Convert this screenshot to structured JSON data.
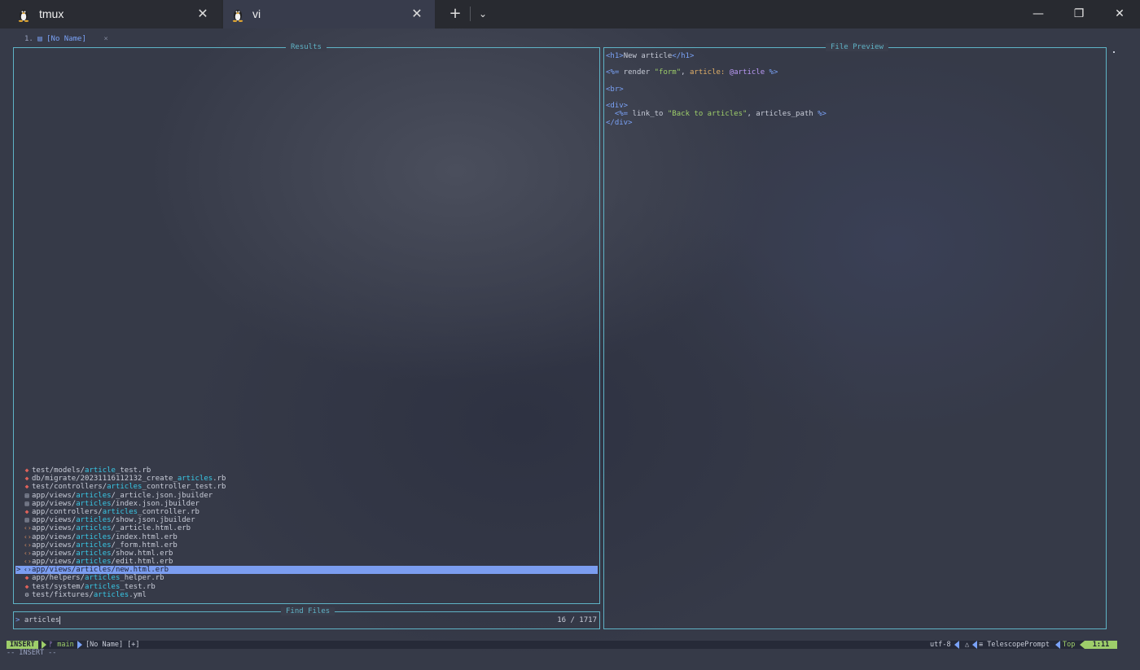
{
  "window": {
    "tabs": [
      {
        "label": "tmux",
        "icon": "linux-penguin-icon"
      },
      {
        "label": "vi",
        "icon": "linux-penguin-icon"
      }
    ],
    "close_glyph": "✕",
    "new_tab_glyph": "+",
    "dropdown_glyph": "⌄",
    "minimize_glyph": "—",
    "maximize_glyph": "❐",
    "close_window_glyph": "✕"
  },
  "bufferline": {
    "number": "1.",
    "icon": "document-icon",
    "icon_glyph": "▤",
    "name": "[No Name]",
    "close": "×"
  },
  "telescope": {
    "results_title": "Results",
    "preview_title": "File Preview",
    "prompt_title": "Find Files",
    "prompt_prefix": ">",
    "query": "articles",
    "count": "16 / 1717",
    "results": [
      {
        "icon": "ruby",
        "glyph": "◆",
        "pre": "test/models/",
        "match": "article",
        "post": "_test.rb"
      },
      {
        "icon": "ruby",
        "glyph": "◆",
        "pre": "db/migrate/20231116112132_create_",
        "match": "articles",
        "post": ".rb"
      },
      {
        "icon": "ruby",
        "glyph": "◆",
        "pre": "test/controllers/",
        "match": "articles",
        "post": "_controller_test.rb"
      },
      {
        "icon": "doc",
        "glyph": "▤",
        "pre": "app/views/",
        "match": "articles",
        "post": "/_article.json.jbuilder"
      },
      {
        "icon": "doc",
        "glyph": "▤",
        "pre": "app/views/",
        "match": "articles",
        "post": "/index.json.jbuilder"
      },
      {
        "icon": "ruby",
        "glyph": "◆",
        "pre": "app/controllers/",
        "match": "articles",
        "post": "_controller.rb"
      },
      {
        "icon": "doc",
        "glyph": "▤",
        "pre": "app/views/",
        "match": "articles",
        "post": "/show.json.jbuilder"
      },
      {
        "icon": "erb",
        "glyph": "‹›",
        "pre": "app/views/",
        "match": "articles",
        "post": "/_article.html.erb"
      },
      {
        "icon": "erb",
        "glyph": "‹›",
        "pre": "app/views/",
        "match": "articles",
        "post": "/index.html.erb"
      },
      {
        "icon": "erb",
        "glyph": "‹›",
        "pre": "app/views/",
        "match": "articles",
        "post": "/_form.html.erb"
      },
      {
        "icon": "erb",
        "glyph": "‹›",
        "pre": "app/views/",
        "match": "articles",
        "post": "/show.html.erb"
      },
      {
        "icon": "erb",
        "glyph": "‹›",
        "pre": "app/views/",
        "match": "articles",
        "post": "/edit.html.erb"
      },
      {
        "icon": "erb",
        "glyph": "‹›",
        "pre": "app/views/",
        "match": "articles",
        "post": "/new.html.erb",
        "selected": true
      },
      {
        "icon": "ruby",
        "glyph": "◆",
        "pre": "app/helpers/",
        "match": "articles",
        "post": "_helper.rb"
      },
      {
        "icon": "ruby",
        "glyph": "◆",
        "pre": "test/system/",
        "match": "articles",
        "post": "_test.rb"
      },
      {
        "icon": "yml",
        "glyph": "⚙",
        "pre": "test/fixtures/",
        "match": "articles",
        "post": ".yml"
      }
    ],
    "selected_marker": ">",
    "preview": [
      [
        {
          "c": "tag",
          "t": "<h1>"
        },
        {
          "c": "plain",
          "t": "New article"
        },
        {
          "c": "tag",
          "t": "</h1>"
        }
      ],
      [],
      [
        {
          "c": "tag",
          "t": "<%="
        },
        {
          "c": "plain",
          "t": " render "
        },
        {
          "c": "str",
          "t": "\"form\""
        },
        {
          "c": "plain",
          "t": ", "
        },
        {
          "c": "kw",
          "t": "article:"
        },
        {
          "c": "plain",
          "t": " "
        },
        {
          "c": "sym",
          "t": "@article"
        },
        {
          "c": "plain",
          "t": " "
        },
        {
          "c": "tag",
          "t": "%>"
        }
      ],
      [],
      [
        {
          "c": "tag",
          "t": "<br>"
        }
      ],
      [],
      [
        {
          "c": "tag",
          "t": "<div>"
        }
      ],
      [
        {
          "c": "plain",
          "t": "  "
        },
        {
          "c": "tag",
          "t": "<%="
        },
        {
          "c": "plain",
          "t": " link_to "
        },
        {
          "c": "str",
          "t": "\"Back to articles\""
        },
        {
          "c": "plain",
          "t": ", articles_path "
        },
        {
          "c": "tag",
          "t": "%>"
        }
      ],
      [
        {
          "c": "tag",
          "t": "</div>"
        }
      ]
    ]
  },
  "statusline": {
    "mode": "INSERT",
    "branch_icon": "git-branch-icon",
    "branch_glyph": "ᚠ",
    "branch": "main",
    "filename": "[No Name] [+]",
    "encoding": "utf-8",
    "fileformat_glyph": "△",
    "filetype_glyph": "≡",
    "filetype": "TelescopePrompt",
    "position": "Top",
    "location": "1:11"
  },
  "cmdline": "-- INSERT --",
  "colors": {
    "border": "#5fb3c6",
    "match_highlight": "#38c8e6",
    "selection": "#7b9df0",
    "mode_bg": "#9ece6a"
  }
}
